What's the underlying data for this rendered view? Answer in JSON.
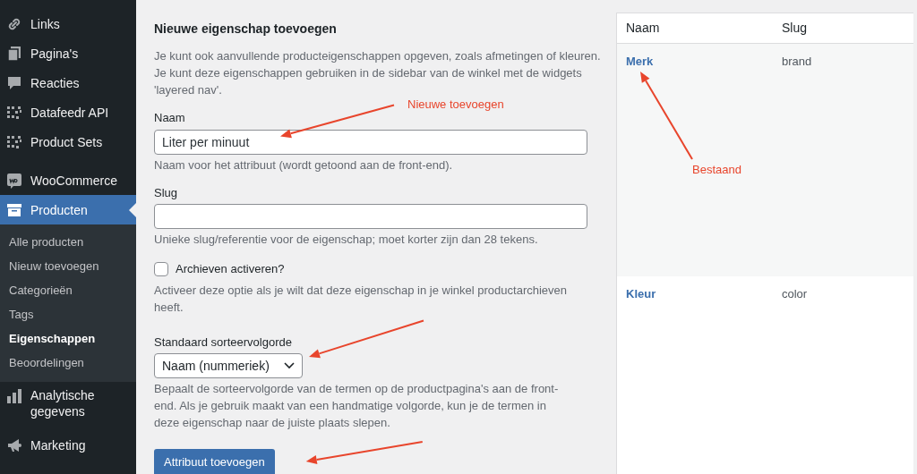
{
  "sidebar": {
    "items": [
      {
        "label": "Links",
        "selected": false
      },
      {
        "label": "Pagina's",
        "selected": false
      },
      {
        "label": "Reacties",
        "selected": false
      },
      {
        "label": "Datafeedr API",
        "selected": false
      },
      {
        "label": "Product Sets",
        "selected": false
      },
      {
        "label": "WooCommerce",
        "selected": false
      },
      {
        "label": "Producten",
        "selected": true,
        "children": [
          {
            "label": "Alle producten",
            "selected": false
          },
          {
            "label": "Nieuw toevoegen",
            "selected": false
          },
          {
            "label": "Categorieën",
            "selected": false
          },
          {
            "label": "Tags",
            "selected": false
          },
          {
            "label": "Eigenschappen",
            "selected": true
          },
          {
            "label": "Beoordelingen",
            "selected": false
          }
        ]
      },
      {
        "label": "Analytische gegevens",
        "selected": false
      },
      {
        "label": "Marketing",
        "selected": false
      }
    ]
  },
  "form": {
    "title": "Nieuwe eigenschap toevoegen",
    "description": "Je kunt ook aanvullende producteigenschappen opgeven, zoals afmetingen of kleuren. Je kunt deze eigenschappen gebruiken in de sidebar van de winkel met de widgets 'layered nav'.",
    "fields": [
      {
        "kind": "text",
        "label": "Naam",
        "value": "Liter per minuut",
        "hint": "Naam voor het attribuut (wordt getoond aan de front-end)."
      },
      {
        "kind": "text",
        "label": "Slug",
        "hint": "Unieke slug/referentie voor de eigenschap; moet korter zijn dan 28 tekens."
      },
      {
        "kind": "checkbox",
        "label": "Archieven activeren?",
        "checked": false,
        "hint": "Activeer deze optie als je wilt dat deze eigenschap in je winkel productarchieven heeft."
      },
      {
        "kind": "select",
        "label": "Standaard sorteervolgorde",
        "value": "Naam (nummeriek)",
        "hint": "Bepaalt de sorteervolgorde van de termen op de productpagina's aan de front-end. Als je gebruik maakt van een handmatige volgorde, kun je de termen in deze eigenschap naar de juiste plaats slepen."
      }
    ],
    "submit": "Attribuut toevoegen"
  },
  "table": {
    "columns": [
      "Naam",
      "Slug"
    ],
    "rows": [
      {
        "name": "Merk",
        "slug": "brand"
      },
      {
        "name": "Kleur",
        "slug": "color"
      }
    ]
  },
  "annotations": [
    {
      "text": "Nieuwe toevoegen"
    },
    {
      "text": "Bestaand"
    }
  ]
}
